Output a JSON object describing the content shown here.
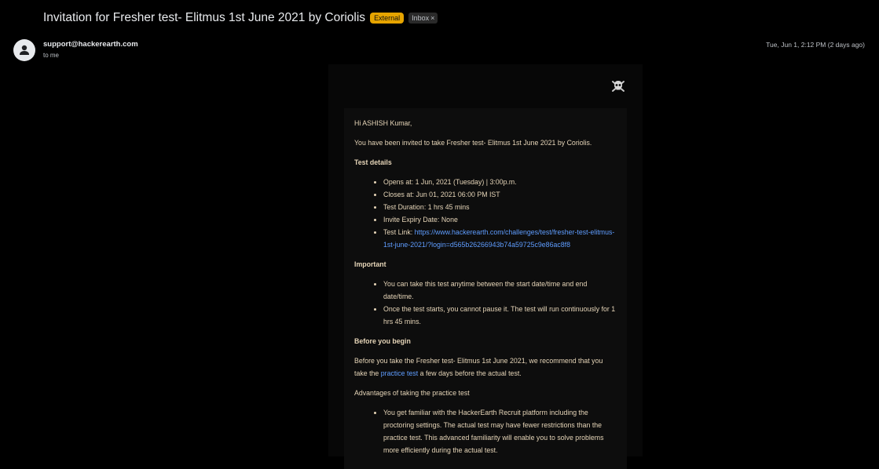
{
  "subject": "Invitation for Fresher test- Elitmus 1st June 2021 by Coriolis",
  "labels": {
    "external": "External",
    "inbox": "Inbox",
    "inbox_close": "×"
  },
  "sender": {
    "email": "support@hackerearth.com",
    "to": "to me",
    "date": "Tue, Jun 1, 2:12 PM (2 days ago)"
  },
  "body": {
    "greeting": "Hi ASHISH Kumar,",
    "intro": "You have been invited to take Fresher test- Elitmus 1st June 2021 by Coriolis.",
    "test_details_heading": "Test details",
    "details": {
      "opens": "Opens at: 1 Jun, 2021 (Tuesday) | 3:00p.m.",
      "closes": "Closes at: Jun 01, 2021 06:00 PM IST",
      "duration": "Test Duration: 1 hrs 45 mins",
      "expiry": "Invite Expiry Date: None",
      "link_label": "Test Link: ",
      "link_url": "https://www.hackerearth.com/challenges/test/fresher-test-elitmus-1st-june-2021/?login=d565b26266943b74a59725c9e86ac8f8"
    },
    "important_heading": "Important",
    "important": {
      "anytime": "You can take this test anytime between the start date/time and end date/time.",
      "no_pause": "Once the test starts, you cannot pause it. The test will run continuously for 1 hrs 45 mins."
    },
    "before_heading": "Before you begin",
    "before": {
      "text_pre": "Before you take the Fresher test- Elitmus 1st June 2021, we recommend that you take the ",
      "practice_link": "practice test",
      "text_post": " a few days before the actual test."
    },
    "advantages_heading": "Advantages of taking the practice test",
    "advantages": {
      "familiar": "You get familiar with the HackerEarth Recruit platform including the proctoring settings. The actual test may have fewer restrictions than the practice test. This advanced familiarity will enable you to solve problems more efficiently during the actual test."
    }
  },
  "icons": {
    "avatar": "person-icon",
    "logo": "pirate-logo-icon"
  }
}
